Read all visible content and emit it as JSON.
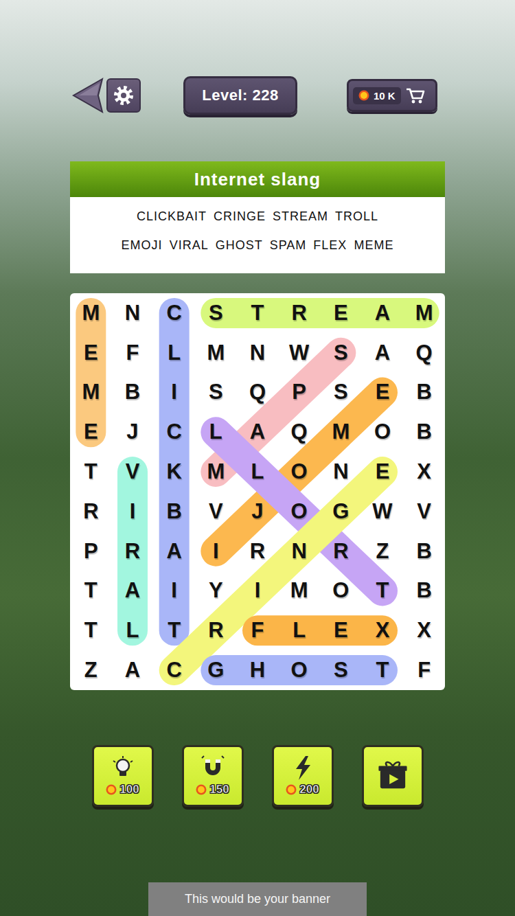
{
  "header": {
    "level": "Level: 228",
    "coins": "10 K"
  },
  "category": "Internet slang",
  "words": [
    "CLICKBAIT",
    "CRINGE",
    "STREAM",
    "TROLL",
    "EMOJI",
    "VIRAL",
    "GHOST",
    "SPAM",
    "FLEX",
    "MEME"
  ],
  "grid": [
    [
      "M",
      "N",
      "C",
      "S",
      "T",
      "R",
      "E",
      "A",
      "M"
    ],
    [
      "E",
      "F",
      "L",
      "M",
      "N",
      "W",
      "S",
      "A",
      "Q"
    ],
    [
      "M",
      "B",
      "I",
      "S",
      "Q",
      "P",
      "S",
      "E",
      "B"
    ],
    [
      "E",
      "J",
      "C",
      "L",
      "A",
      "Q",
      "M",
      "O",
      "B"
    ],
    [
      "T",
      "V",
      "K",
      "M",
      "L",
      "O",
      "N",
      "E",
      "X"
    ],
    [
      "R",
      "I",
      "B",
      "V",
      "J",
      "O",
      "G",
      "W",
      "V"
    ],
    [
      "P",
      "R",
      "A",
      "I",
      "R",
      "N",
      "R",
      "Z",
      "B"
    ],
    [
      "T",
      "A",
      "I",
      "Y",
      "I",
      "M",
      "O",
      "T",
      "B"
    ],
    [
      "T",
      "L",
      "T",
      "R",
      "F",
      "L",
      "E",
      "X",
      "X"
    ],
    [
      "Z",
      "A",
      "C",
      "G",
      "H",
      "O",
      "S",
      "T",
      "F"
    ]
  ],
  "found": [
    {
      "word": "MEME",
      "color": "#fbc97f",
      "start": [
        0,
        0
      ],
      "end": [
        3,
        0
      ]
    },
    {
      "word": "CLICKBAIT",
      "color": "#a9b6f8",
      "start": [
        0,
        2
      ],
      "end": [
        8,
        2
      ]
    },
    {
      "word": "STREAM",
      "color": "#d8f87d",
      "start": [
        0,
        3
      ],
      "end": [
        0,
        8
      ]
    },
    {
      "word": "VIRAL",
      "color": "#a2f6df",
      "start": [
        4,
        1
      ],
      "end": [
        8,
        1
      ]
    },
    {
      "word": "SPAM",
      "color": "#f8bdc1",
      "start": [
        1,
        6
      ],
      "end": [
        4,
        3
      ]
    },
    {
      "word": "EMOJI",
      "color": "#fcb84f",
      "start": [
        2,
        7
      ],
      "end": [
        6,
        3
      ]
    },
    {
      "word": "TROLL",
      "color": "#c6a5f5",
      "start": [
        7,
        7
      ],
      "end": [
        3,
        3
      ]
    },
    {
      "word": "CRINGE",
      "color": "#f3f67c",
      "start": [
        9,
        2
      ],
      "end": [
        4,
        7
      ]
    },
    {
      "word": "FLEX",
      "color": "#fbb548",
      "start": [
        8,
        4
      ],
      "end": [
        8,
        7
      ]
    },
    {
      "word": "GHOST",
      "color": "#a9b6f8",
      "start": [
        9,
        3
      ],
      "end": [
        9,
        7
      ]
    }
  ],
  "boosters": [
    {
      "kind": "hint",
      "cost": "100"
    },
    {
      "kind": "magnet",
      "cost": "150"
    },
    {
      "kind": "lightning",
      "cost": "200"
    },
    {
      "kind": "gift",
      "cost": ""
    }
  ],
  "banner": "This would be your banner"
}
